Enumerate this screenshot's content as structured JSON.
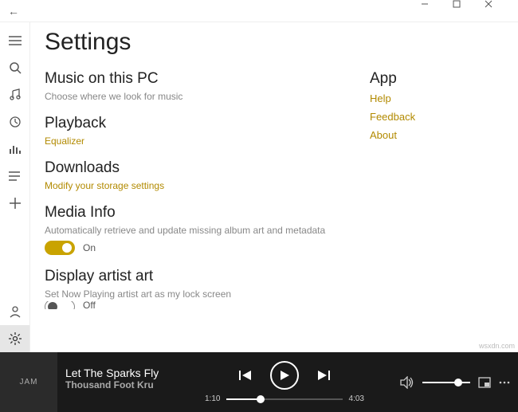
{
  "window": {
    "back_icon": "←"
  },
  "page": {
    "title": "Settings"
  },
  "sections": {
    "music": {
      "heading": "Music on this PC",
      "desc": "Choose where we look for music"
    },
    "playback": {
      "heading": "Playback",
      "link": "Equalizer"
    },
    "downloads": {
      "heading": "Downloads",
      "link": "Modify your storage settings"
    },
    "media_info": {
      "heading": "Media Info",
      "desc": "Automatically retrieve and update missing album art and metadata",
      "toggle_state": "On"
    },
    "artist_art": {
      "heading": "Display artist art",
      "desc": "Set Now Playing artist art as my lock screen",
      "toggle_state": "Off"
    }
  },
  "app": {
    "heading": "App",
    "links": [
      "Help",
      "Feedback",
      "About"
    ]
  },
  "player": {
    "album_art_text": "JAM",
    "track_title": "Let The Sparks Fly",
    "track_artist": "Thousand Foot Kru",
    "elapsed": "1:10",
    "duration": "4:03"
  },
  "watermark": "wsxdn.com"
}
